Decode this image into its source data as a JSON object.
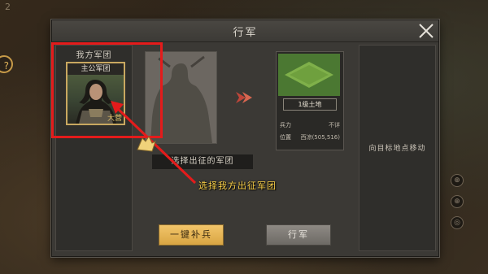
{
  "background": {
    "corner_number": "2",
    "left_round_button": "?",
    "side_icons": [
      "⊕",
      "⊕",
      "◎"
    ]
  },
  "modal": {
    "title": "行军",
    "left_panel": {
      "heading": "我方军团",
      "legion": {
        "name": "主公军团",
        "hero_label": "大营"
      }
    },
    "center": {
      "select_label": "选择出征的军团"
    },
    "target": {
      "terrain_name": "1级土地",
      "rows": [
        {
          "label": "兵力",
          "value": "不详"
        },
        {
          "label": "位置",
          "value": "西凉(505,516)"
        }
      ]
    },
    "right_panel": {
      "hint": "向目标地点移动"
    },
    "buttons": {
      "supply": "一键补兵",
      "march": "行军"
    }
  },
  "tutorial": {
    "hint_text": "选择我方出征军团",
    "colors": {
      "highlight": "#e41b1b",
      "hint": "#ffd44a"
    }
  }
}
